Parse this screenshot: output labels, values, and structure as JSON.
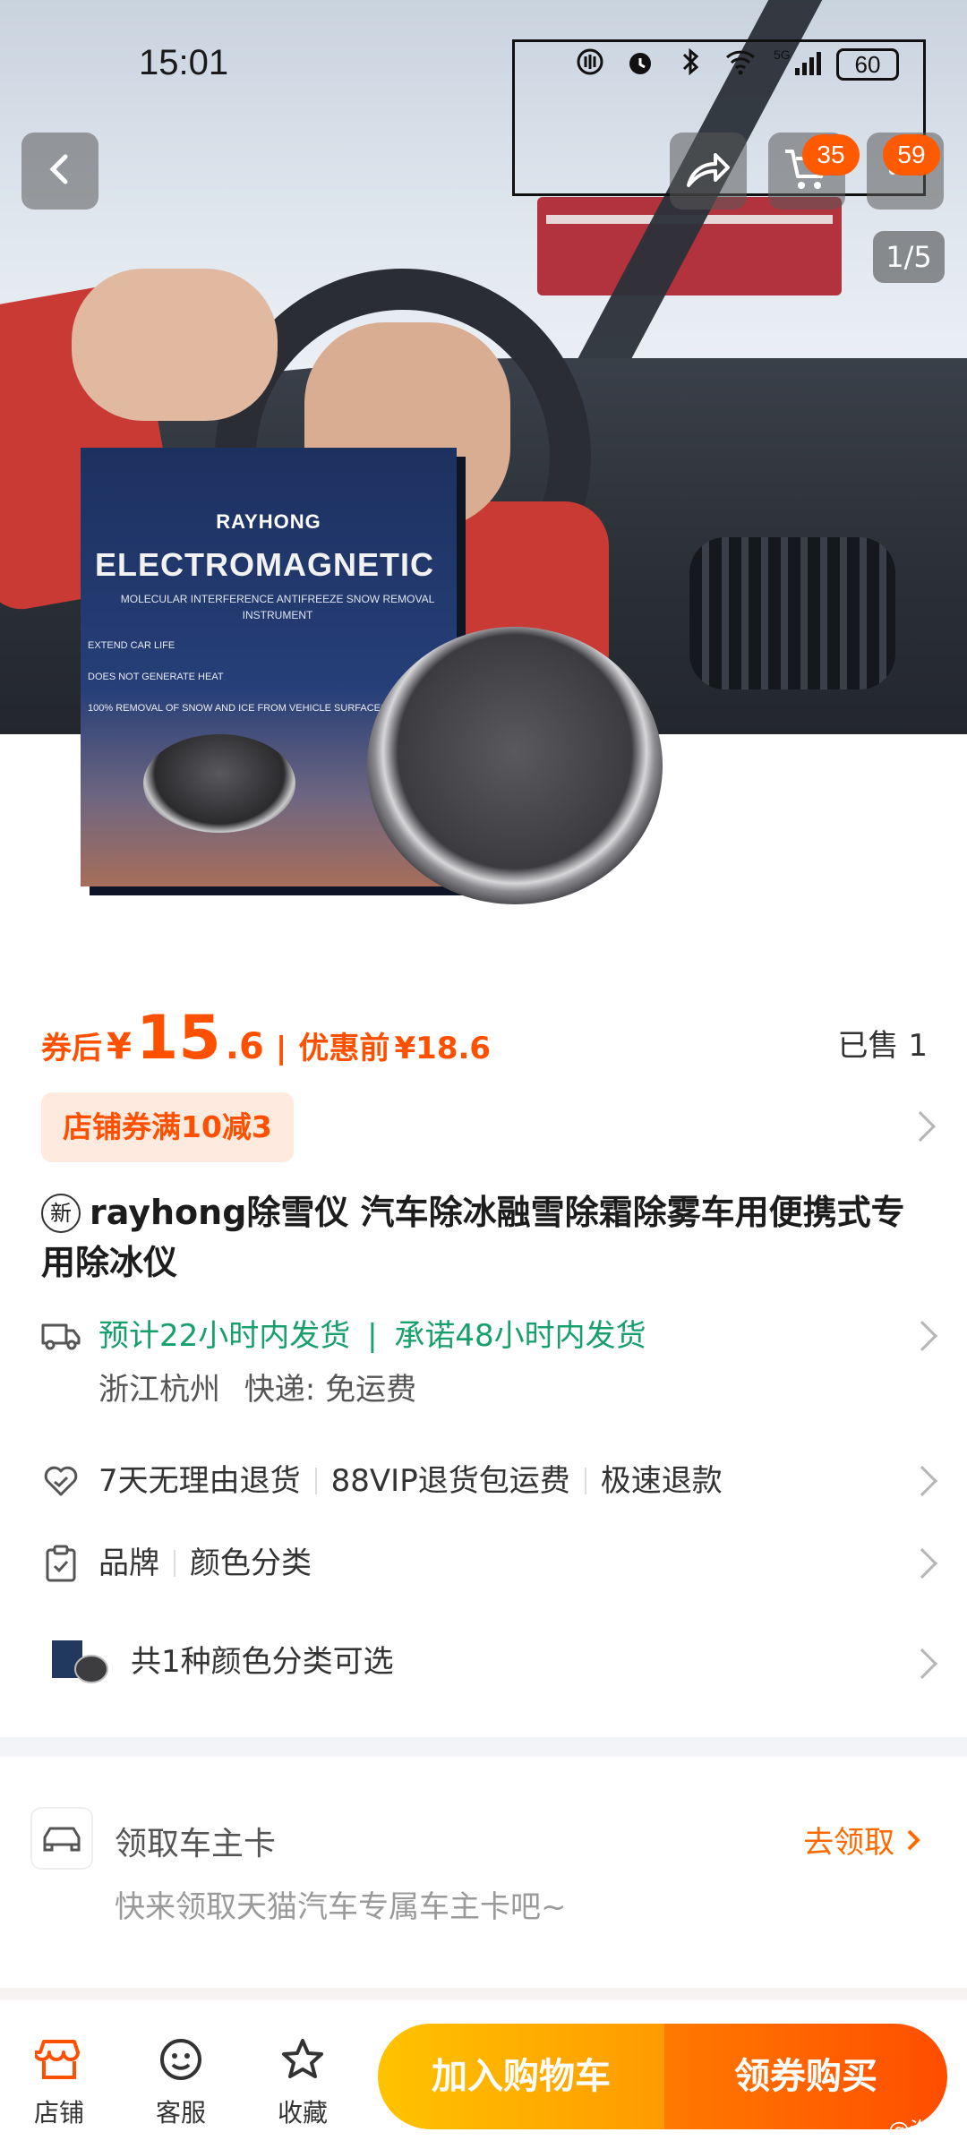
{
  "status_bar": {
    "time": "15:01",
    "network": "5G",
    "battery": "60"
  },
  "hero": {
    "box_brand": "RAYHONG",
    "box_headline": "ELECTROMAGNETIC",
    "box_sub": "MOLECULAR INTERFERENCE ANTIFREEZE SNOW REMOVAL INSTRUMENT",
    "box_bullets": [
      "EXTEND CAR LIFE",
      "DOES NOT GENERATE HEAT",
      "100% REMOVAL OF SNOW AND ICE FROM VEHICLE SURFACES"
    ],
    "cart_badge": "35",
    "more_badge": "59",
    "image_counter": "1/5"
  },
  "price": {
    "after_label": "券后",
    "yen": "¥",
    "integer": "15",
    "decimal": ".6",
    "separator": "|",
    "before_label": "优惠前",
    "before_price": "¥18.6",
    "sold": "已售 1"
  },
  "coupon": {
    "label": "店铺券满10减3"
  },
  "product": {
    "new_tag": "新",
    "title": "rayhong除雪仪 汽车除冰融雪除霜除雾车用便携式专用除冰仪"
  },
  "shipping": {
    "eta": "预计22小时内发货",
    "separator": "|",
    "promise": "承诺48小时内发货",
    "origin": "浙江杭州",
    "courier": "快递: 免运费"
  },
  "services": {
    "items": [
      "7天无理由退货",
      "88VIP退货包运费",
      "极速退款"
    ]
  },
  "params": {
    "items": [
      "品牌",
      "颜色分类"
    ]
  },
  "sku": {
    "label": "共1种颜色分类可选"
  },
  "owner_card": {
    "title": "领取车主卡",
    "subtitle": "快来领取天猫汽车专属车主卡吧~",
    "action": "去领取"
  },
  "bottom_bar": {
    "tabs": [
      "店铺",
      "客服",
      "收藏"
    ],
    "add_to_cart": "加入购物车",
    "buy": "领券购买",
    "watermark": "@汽车"
  },
  "colors": {
    "accent": "#ff5000",
    "green": "#17a06b",
    "cart_btn": "#ffb000",
    "buy_btn": "#ff5a00"
  }
}
